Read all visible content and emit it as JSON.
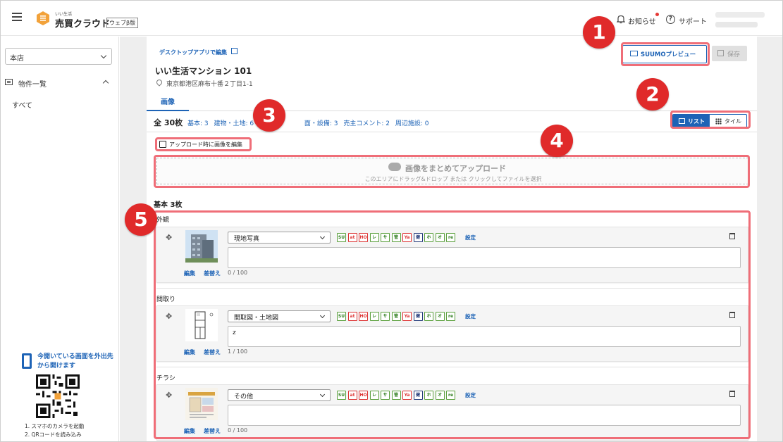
{
  "header": {
    "brand_small": "いい生活",
    "brand_main": "売買クラウド",
    "brand_badge": "ウェブβ版",
    "notifications_label": "お知らせ",
    "support_label": "サポート"
  },
  "sidebar": {
    "store_select_value": "本店",
    "section_label": "物件一覧",
    "sub_item": "すべて",
    "qr_promo_text": "今開いている画面を外出先から開けます",
    "qr_steps": [
      "1. スマホのカメラを起動",
      "2. QRコードを読み込み"
    ]
  },
  "toolbar": {
    "desktop_link": "デスクトップアプリで編集",
    "preview_label": "SUUMOプレビュー",
    "save_label": "保存"
  },
  "property": {
    "title": "いい生活マンション 101",
    "address": "東京都港区麻布十番２丁目1-1"
  },
  "tabs": {
    "image": "画像"
  },
  "counts": {
    "total": "全 30枚",
    "items": [
      "基本: 3",
      "建物・土地: 6",
      "",
      "",
      "面・設備: 3",
      "売主コメント: 2",
      "周辺施設: 0"
    ]
  },
  "view_toggle": {
    "list": "リスト",
    "tile": "タイル"
  },
  "upload": {
    "edit_checkbox_label": "アップロード時に画像を編集",
    "title": "画像をまとめてアップロード",
    "subtitle": "このエリアにドラッグ&ドロップ または クリックしてファイルを選択"
  },
  "section": {
    "count_label": "基本 3枚"
  },
  "tags": [
    "SU",
    "at",
    "HO",
    "レ",
    "サ",
    "管",
    "Ya",
    "健",
    "ホ",
    "オ",
    "re"
  ],
  "settings_label": "設定",
  "edit_label": "編集",
  "replace_label": "差替え",
  "cards": [
    {
      "category": "外観",
      "type": "現地写真",
      "comment": "",
      "char_count": "0 / 100"
    },
    {
      "category": "間取り",
      "type": "間取図・土地図",
      "comment": "z",
      "char_count": "1 / 100"
    },
    {
      "category": "チラシ",
      "type": "その他",
      "comment": "",
      "char_count": "0 / 100"
    }
  ],
  "markers": [
    "1",
    "2",
    "3",
    "4",
    "5"
  ],
  "colors": {
    "accent": "#1d63b6",
    "marker": "#e02a2a",
    "highlight": "#ef6e78",
    "tag_green": "#5aa03c",
    "tag_red": "#dd3333",
    "tag_navy": "#243b7a"
  }
}
